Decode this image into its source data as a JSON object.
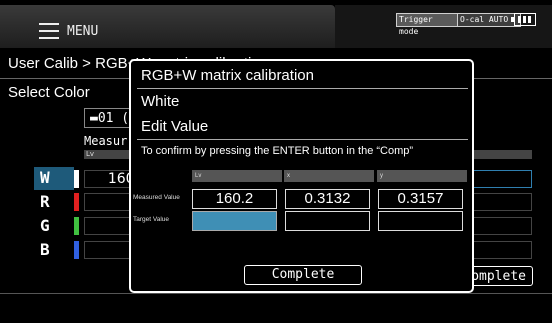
{
  "header": {
    "menu_label": "MENU",
    "trigger_badge": "Trigger mode",
    "cal_badge": "O-cal AUTO",
    "battery_icon": "battery-icon"
  },
  "page": {
    "breadcrumb": "User Calib > RGB+W matrix calibration",
    "select_color_label": "Select Color",
    "file_field_value": "01 (",
    "measured_label": "Measur",
    "lv_header": "Lv",
    "rows": [
      {
        "letter": "W",
        "color": "#ffffff",
        "value": "160."
      },
      {
        "letter": "R",
        "color": "#e02020",
        "value": ""
      },
      {
        "letter": "G",
        "color": "#40c040",
        "value": ""
      },
      {
        "letter": "B",
        "color": "#3060e0",
        "value": ""
      }
    ],
    "complete_button": "Complete"
  },
  "dialog": {
    "title": "RGB+W matrix calibration",
    "color": "White",
    "mode": "Edit Value",
    "instruction": "To confirm by pressing the ENTER button in the “Comp”",
    "columns": [
      "Lv",
      "x",
      "y"
    ],
    "measured_label": "Measured Value",
    "target_label": "Target Value",
    "measured_values": [
      "160.2",
      "0.3132",
      "0.3157"
    ],
    "target_values": [
      "",
      "",
      ""
    ],
    "complete_button": "Complete"
  },
  "colors": {
    "accent": "#3f8fb5",
    "highlight_row": "#1e5a7a"
  }
}
